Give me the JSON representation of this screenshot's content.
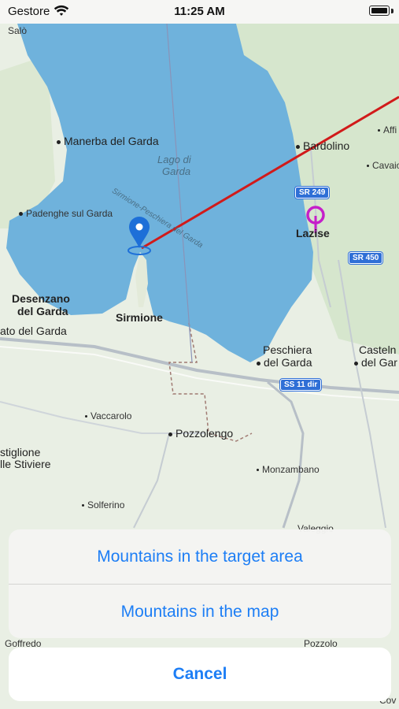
{
  "status_bar": {
    "carrier": "Gestore",
    "time": "11:25 AM"
  },
  "map": {
    "labels": {
      "salo": "Salò",
      "manerba": "Manerba del Garda",
      "bardolino": "Bardolino",
      "lago_line1": "Lago di",
      "lago_line2": "Garda",
      "sirmione_peschiera": "Sirmione-Peschiera del Garda",
      "padenghe": "Padenghe sul Garda",
      "lazise": "Lazise",
      "desenzano_line1": "Desenzano",
      "desenzano_line2": "del Garda",
      "sirmione": "Sirmione",
      "lonato": "ato del Garda",
      "peschiera_line1": "Peschiera",
      "peschiera_line2": "del Garda",
      "castelnuovo_line1": "Casteln",
      "castelnuovo_line2": "del Gar",
      "vaccarolo": "Vaccarolo",
      "pozzolengo": "Pozzolengo",
      "castiglione_line1": "stiglione",
      "castiglione_line2": "lle Stiviere",
      "monzambano": "Monzambano",
      "solferino": "Solferino",
      "goffredo": "Goffredo",
      "pozzolo": "Pozzolo",
      "valeggio": "Valeggio",
      "affi": "Affi",
      "cavaion": "Cavaio",
      "cov": "Cov"
    },
    "shields": {
      "sr249": "SR 249",
      "sr450": "SR 450",
      "ss11dir": "SS 11 dir"
    },
    "colors": {
      "water": "#6fb2dc",
      "land": "#e9efe4",
      "route": "#d11a1a",
      "origin_pin": "#1d6fd8",
      "target_pin": "#c51fc9"
    }
  },
  "action_sheet": {
    "options": [
      {
        "label": "Mountains in the target area"
      },
      {
        "label": "Mountains in the map"
      }
    ],
    "cancel_label": "Cancel"
  }
}
